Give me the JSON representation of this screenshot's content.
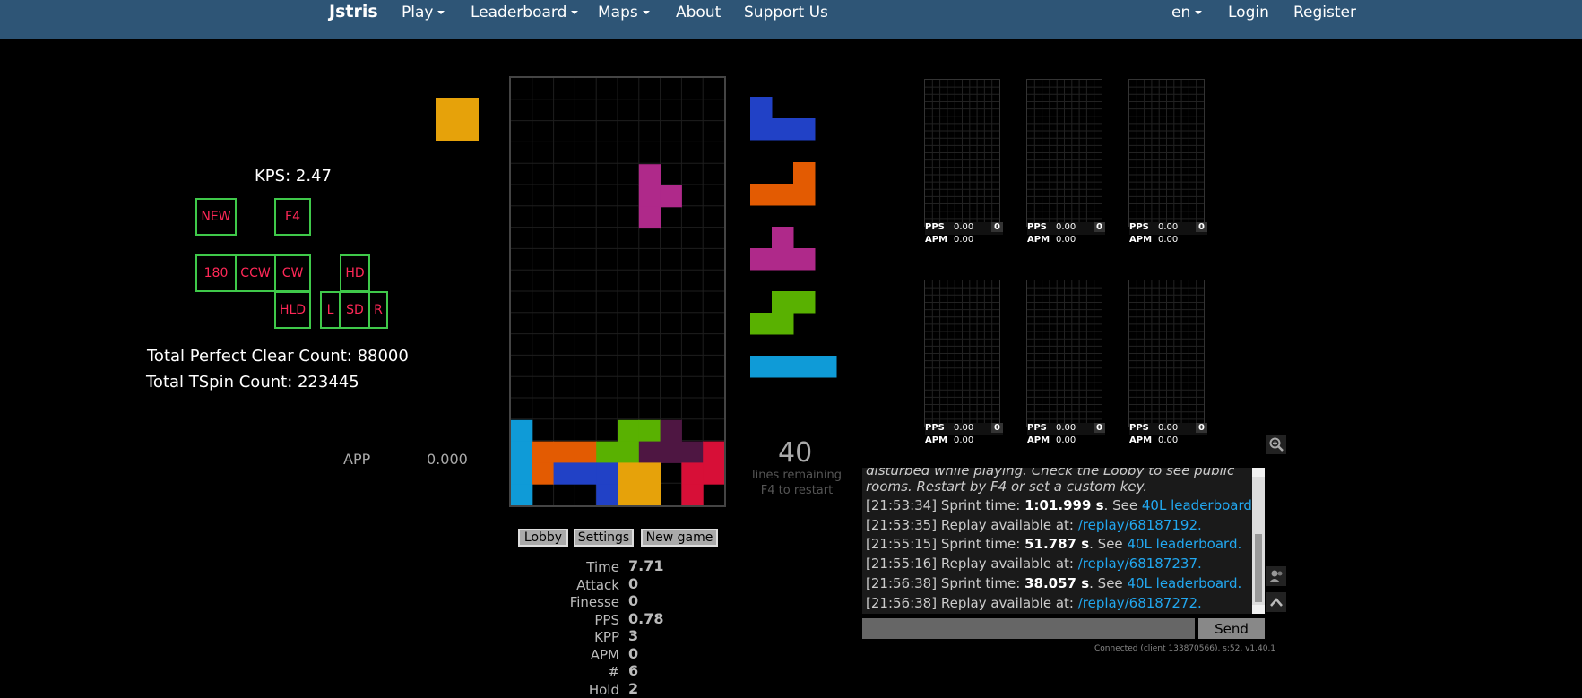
{
  "navbar": {
    "brand": "Jstris",
    "items": [
      {
        "label": "Play",
        "dropdown": true
      },
      {
        "label": "Leaderboard",
        "dropdown": true
      },
      {
        "label": "Maps",
        "dropdown": true
      },
      {
        "label": "About",
        "dropdown": false
      },
      {
        "label": "Support Us",
        "dropdown": false
      }
    ],
    "right": [
      {
        "label": "en",
        "dropdown": true
      },
      {
        "label": "Login",
        "dropdown": false
      },
      {
        "label": "Register",
        "dropdown": false
      }
    ]
  },
  "left_panel": {
    "kps": "KPS: 2.47",
    "keys": {
      "new": "NEW",
      "f4": "F4",
      "r180": "180",
      "ccw": "CCW",
      "cw": "CW",
      "hd": "HD",
      "hld": "HLD",
      "l": "L",
      "sd": "SD",
      "r": "R"
    },
    "perfect_clear": "Total Perfect Clear Count: 88000",
    "tspin": "Total TSpin Count: 223445",
    "app_label": "APP",
    "app_value": "0.000"
  },
  "colors": {
    "I": "#0f9bd7",
    "J": "#2141c6",
    "L": "#e35b02",
    "O": "#e6a20a",
    "S": "#59b101",
    "T": "#af298a",
    "Z": "#d70f37",
    "garbage": "#4e1642",
    "key_border": "#3fc94a",
    "key_text": "#ff2857",
    "navbar": "#2e5576",
    "link": "#22a8f0"
  },
  "hold_piece": "O",
  "queue": [
    "J",
    "L",
    "T",
    "S",
    "I"
  ],
  "board": {
    "rows": [
      "..........",
      "..........",
      "..........",
      "..........",
      "......T...",
      "......TT..",
      "......T...",
      "..........",
      "..........",
      "..........",
      "..........",
      "..........",
      "..........",
      "..........",
      "..........",
      "..........",
      "I....SSX..",
      "ILLLSSXXXZ",
      "ILJJJOO.ZZ",
      "I...JOO.Z."
    ]
  },
  "countdown": {
    "value": "40",
    "line1": "lines remaining",
    "line2": "F4 to restart"
  },
  "buttons": {
    "lobby": "Lobby",
    "settings": "Settings",
    "new_game": "New game"
  },
  "stats": [
    {
      "label": "Time",
      "value": "7.71"
    },
    {
      "label": "Attack",
      "value": "0"
    },
    {
      "label": "Finesse",
      "value": "0"
    },
    {
      "label": "PPS",
      "value": "0.78"
    },
    {
      "label": "KPP",
      "value": "3"
    },
    {
      "label": "APM",
      "value": "0"
    },
    {
      "label": "#",
      "value": "6"
    },
    {
      "label": "Hold",
      "value": "2"
    }
  ],
  "mini_boards": {
    "pps_label": "PPS",
    "pps_value": "0.00",
    "apm_label": "APM",
    "apm_value": "0.00",
    "count": "0"
  },
  "chat": {
    "partial_line1": "disturbed while playing. Check the Lobby to see public",
    "partial_line2": "rooms. Restart by F4 or set a custom key.",
    "messages": [
      {
        "time": "[21:53:34]",
        "pre": " Sprint time: ",
        "bold": "1:01.999 s",
        "mid": ". See ",
        "link": "40L leaderboard."
      },
      {
        "time": "[21:53:35]",
        "pre": " Replay available at: ",
        "bold": "",
        "mid": "",
        "link": "/replay/68187192."
      },
      {
        "time": "[21:55:15]",
        "pre": " Sprint time: ",
        "bold": "51.787 s",
        "mid": ". See ",
        "link": "40L leaderboard."
      },
      {
        "time": "[21:55:16]",
        "pre": " Replay available at: ",
        "bold": "",
        "mid": "",
        "link": "/replay/68187237."
      },
      {
        "time": "[21:56:38]",
        "pre": " Sprint time: ",
        "bold": "38.057 s",
        "mid": ". See ",
        "link": "40L leaderboard."
      },
      {
        "time": "[21:56:38]",
        "pre": " Replay available at: ",
        "bold": "",
        "mid": "",
        "link": "/replay/68187272."
      }
    ],
    "send": "Send",
    "status": "Connected (client 133870566), s:52, v1.40.1"
  }
}
